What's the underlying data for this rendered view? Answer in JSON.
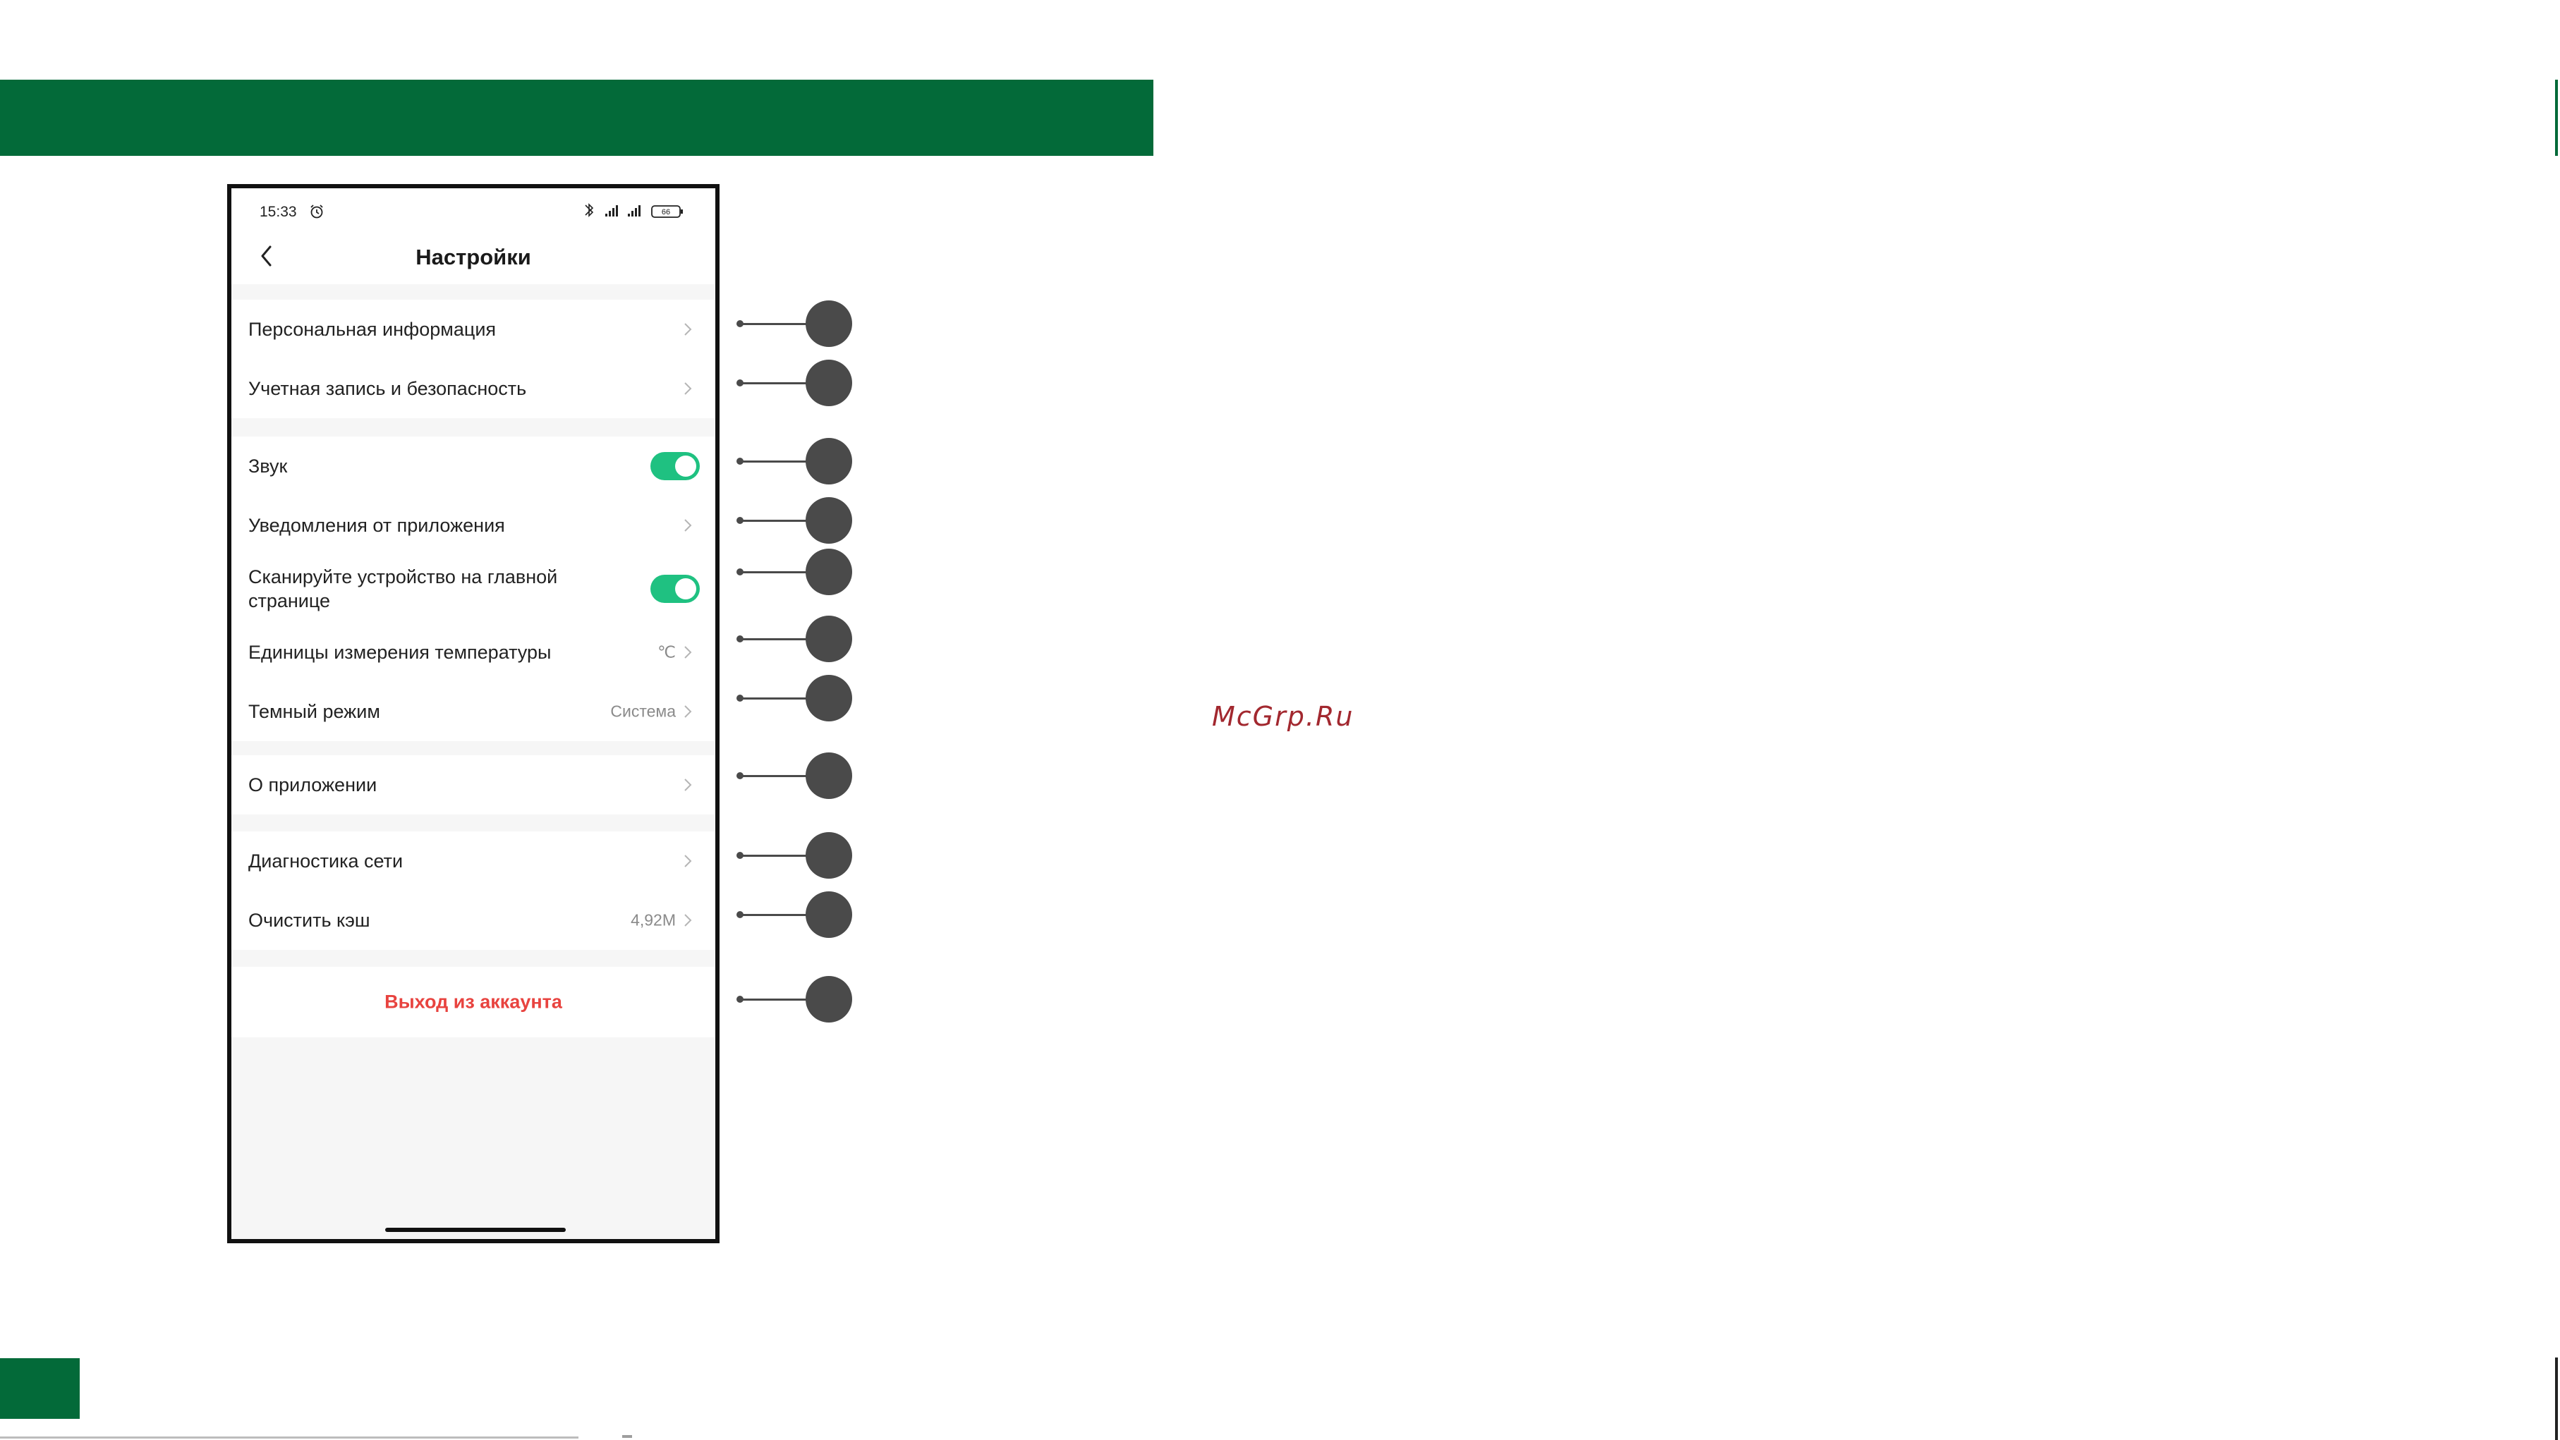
{
  "watermark": "McGrp.Ru",
  "status_bar": {
    "time": "15:33",
    "battery": "66"
  },
  "header": {
    "title": "Настройки"
  },
  "groups": {
    "account": [
      {
        "label": "Персональная информация"
      },
      {
        "label": "Учетная запись и безопасность"
      }
    ],
    "preferences": [
      {
        "label": "Звук",
        "toggle": true
      },
      {
        "label": "Уведомления от приложения"
      },
      {
        "label": "Сканируйте устройство на главной странице",
        "toggle": true
      },
      {
        "label": "Единицы измерения температуры",
        "value": "℃"
      },
      {
        "label": "Темный режим",
        "value": "Система"
      }
    ],
    "about": [
      {
        "label": "О приложении"
      }
    ],
    "tools": [
      {
        "label": "Диагностика сети"
      },
      {
        "label": "Очистить кэш",
        "value": "4,92M"
      }
    ]
  },
  "logout": {
    "label": "Выход из аккаунта",
    "color": "#e8433f"
  },
  "colors": {
    "brand_green": "#036a39",
    "toggle_on": "#1fc181",
    "callout": "#4a4a4a"
  },
  "icons": {
    "back": "chevron-left-icon",
    "row_arrow": "chevron-right-icon",
    "alarm": "alarm-clock-icon",
    "bluetooth": "bluetooth-icon",
    "signal": "signal-icon",
    "battery": "battery-icon"
  }
}
